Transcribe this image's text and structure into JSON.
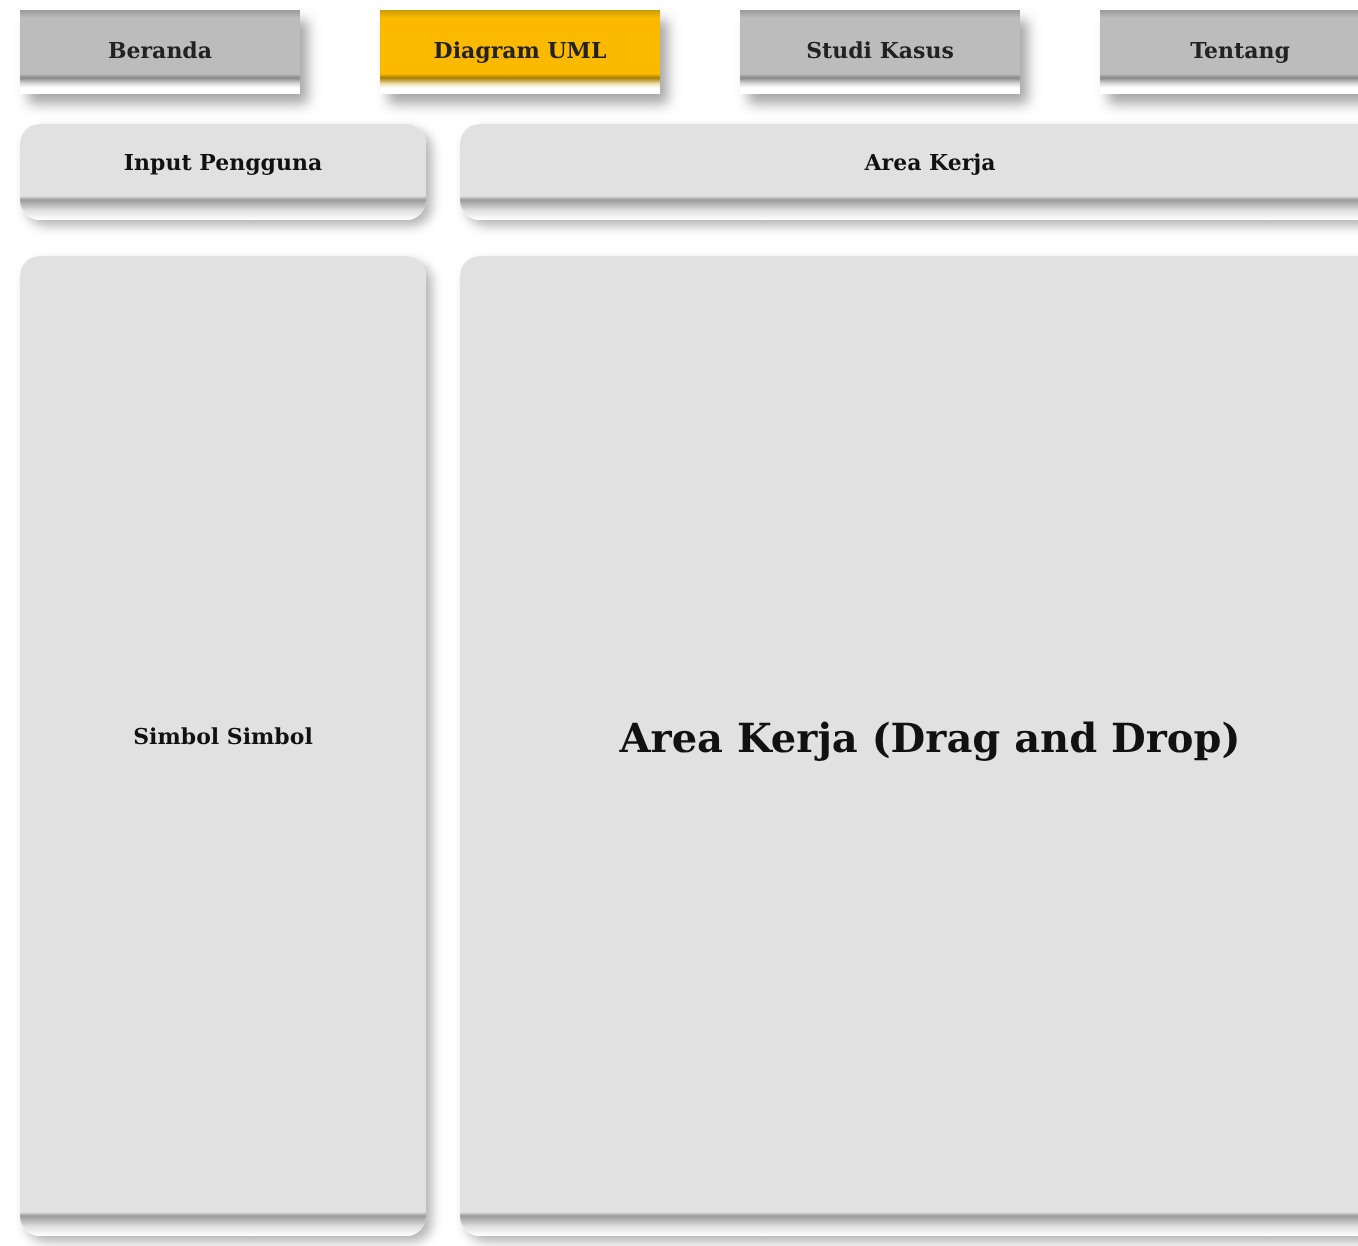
{
  "nav": [
    {
      "label": "Beranda",
      "selected": false
    },
    {
      "label": "Diagram UML",
      "selected": true
    },
    {
      "label": "Studi Kasus",
      "selected": false
    },
    {
      "label": "Tentang",
      "selected": false
    }
  ],
  "headers": {
    "left": "Input Pengguna",
    "right": "Area Kerja"
  },
  "panels": {
    "left": "Simbol Simbol",
    "right": "Area Kerja (Drag and Drop)"
  }
}
